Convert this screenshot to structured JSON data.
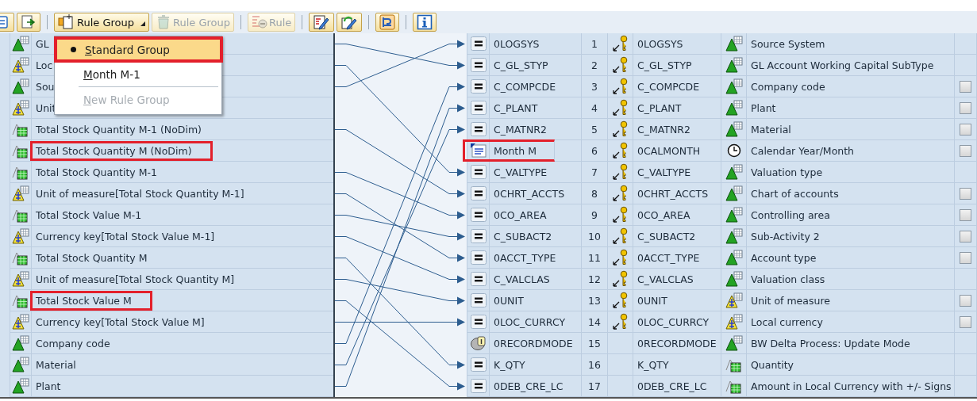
{
  "toolbar": [
    {
      "kind": "icon",
      "disabled": false
    },
    {
      "kind": "icon",
      "disabled": false
    },
    {
      "kind": "separator"
    },
    {
      "kind": "dropdown",
      "label": "Rule Group",
      "disabled": false
    },
    {
      "kind": "text",
      "label": "Rule Group",
      "disabled": true
    },
    {
      "kind": "separator"
    },
    {
      "kind": "text",
      "label": "Rule",
      "disabled": true
    },
    {
      "kind": "separator"
    },
    {
      "kind": "icon",
      "disabled": false
    },
    {
      "kind": "icon",
      "disabled": false
    },
    {
      "kind": "separator"
    },
    {
      "kind": "icon",
      "disabled": false
    },
    {
      "kind": "separator"
    },
    {
      "kind": "icon",
      "disabled": false
    }
  ],
  "menu": [
    {
      "kind": "item",
      "label": "Standard Group",
      "selected": true,
      "highlighted": true,
      "disabled": false
    },
    {
      "kind": "item",
      "label": "Month M-1",
      "selected": false,
      "highlighted": false,
      "disabled": false
    },
    {
      "kind": "separator"
    },
    {
      "kind": "item",
      "label": "New Rule Group",
      "selected": false,
      "highlighted": false,
      "disabled": true
    }
  ],
  "source_rows": [
    {
      "text": "GL",
      "kind": "characteristic",
      "highlighted": false
    },
    {
      "text": "Loc",
      "kind": "unit",
      "highlighted": false
    },
    {
      "text": "Sou",
      "kind": "characteristic",
      "highlighted": false
    },
    {
      "text": "Unit",
      "kind": "unit",
      "highlighted": false
    },
    {
      "text": "Total Stock Quantity M-1 (NoDim)",
      "kind": "keyfigure",
      "highlighted": false
    },
    {
      "text": "Total Stock Quantity M (NoDim)",
      "kind": "keyfigure",
      "highlighted": true
    },
    {
      "text": "Total Stock Quantity M-1",
      "kind": "keyfigure",
      "highlighted": false
    },
    {
      "text": "Unit of measure[Total Stock Quantity M-1]",
      "kind": "unit",
      "highlighted": false
    },
    {
      "text": "Total Stock Value M-1",
      "kind": "keyfigure",
      "highlighted": false
    },
    {
      "text": "Currency key[Total Stock Value M-1]",
      "kind": "unit",
      "highlighted": false
    },
    {
      "text": "Total Stock Quantity M",
      "kind": "keyfigure",
      "highlighted": false
    },
    {
      "text": "Unit of measure[Total Stock Quantity M]",
      "kind": "unit",
      "highlighted": false
    },
    {
      "text": "Total Stock Value M",
      "kind": "keyfigure",
      "highlighted": true
    },
    {
      "text": "Currency key[Total Stock Value M]",
      "kind": "unit",
      "highlighted": false
    },
    {
      "text": "Company code",
      "kind": "characteristic",
      "highlighted": false
    },
    {
      "text": "Material",
      "kind": "characteristic",
      "highlighted": false
    },
    {
      "text": "Plant",
      "kind": "characteristic",
      "highlighted": false
    }
  ],
  "target_rows": [
    {
      "source": {
        "kind": "field",
        "name": "0LOGSYS"
      },
      "number": "1",
      "key": true,
      "linked": true,
      "target": {
        "kind": "characteristic",
        "name": "0LOGSYS",
        "description": "Source System"
      },
      "checkbox": false,
      "highlighted": false
    },
    {
      "source": {
        "kind": "field",
        "name": "C_GL_STYP"
      },
      "number": "2",
      "key": true,
      "linked": true,
      "target": {
        "kind": "characteristic",
        "name": "C_GL_STYP",
        "description": "GL Account Working Capital SubType"
      },
      "checkbox": false,
      "highlighted": false
    },
    {
      "source": {
        "kind": "field",
        "name": "C_COMPCDE"
      },
      "number": "3",
      "key": true,
      "linked": true,
      "target": {
        "kind": "characteristic",
        "name": "C_COMPCDE",
        "description": "Company code"
      },
      "checkbox": true,
      "highlighted": false
    },
    {
      "source": {
        "kind": "field",
        "name": "C_PLANT"
      },
      "number": "4",
      "key": true,
      "linked": true,
      "target": {
        "kind": "characteristic",
        "name": "C_PLANT",
        "description": "Plant"
      },
      "checkbox": true,
      "highlighted": false
    },
    {
      "source": {
        "kind": "field",
        "name": "C_MATNR2"
      },
      "number": "5",
      "key": true,
      "linked": true,
      "target": {
        "kind": "characteristic",
        "name": "C_MATNR2",
        "description": "Material"
      },
      "checkbox": true,
      "highlighted": false
    },
    {
      "source": {
        "kind": "formula",
        "name": "Month M"
      },
      "number": "6",
      "key": true,
      "linked": false,
      "target": {
        "kind": "time",
        "name": "0CALMONTH",
        "description": "Calendar Year/Month"
      },
      "checkbox": true,
      "highlighted": true
    },
    {
      "source": {
        "kind": "field",
        "name": "C_VALTYPE"
      },
      "number": "7",
      "key": true,
      "linked": true,
      "target": {
        "kind": "characteristic",
        "name": "C_VALTYPE",
        "description": "Valuation type"
      },
      "checkbox": false,
      "highlighted": false
    },
    {
      "source": {
        "kind": "field",
        "name": "0CHRT_ACCTS"
      },
      "number": "8",
      "key": true,
      "linked": true,
      "target": {
        "kind": "characteristic",
        "name": "0CHRT_ACCTS",
        "description": "Chart of accounts"
      },
      "checkbox": true,
      "highlighted": false
    },
    {
      "source": {
        "kind": "field",
        "name": "0CO_AREA"
      },
      "number": "9",
      "key": true,
      "linked": true,
      "target": {
        "kind": "characteristic",
        "name": "0CO_AREA",
        "description": "Controlling area"
      },
      "checkbox": true,
      "highlighted": false
    },
    {
      "source": {
        "kind": "field",
        "name": "C_SUBACT2"
      },
      "number": "10",
      "key": true,
      "linked": true,
      "target": {
        "kind": "characteristic",
        "name": "C_SUBACT2",
        "description": "Sub-Activity 2"
      },
      "checkbox": true,
      "highlighted": false
    },
    {
      "source": {
        "kind": "field",
        "name": "0ACCT_TYPE"
      },
      "number": "11",
      "key": true,
      "linked": true,
      "target": {
        "kind": "characteristic",
        "name": "0ACCT_TYPE",
        "description": "Account type"
      },
      "checkbox": true,
      "highlighted": false
    },
    {
      "source": {
        "kind": "field",
        "name": "C_VALCLAS"
      },
      "number": "12",
      "key": true,
      "linked": true,
      "target": {
        "kind": "characteristic",
        "name": "C_VALCLAS",
        "description": "Valuation class"
      },
      "checkbox": false,
      "highlighted": false
    },
    {
      "source": {
        "kind": "field",
        "name": "0UNIT"
      },
      "number": "13",
      "key": true,
      "linked": true,
      "target": {
        "kind": "unit",
        "name": "0UNIT",
        "description": "Unit of measure"
      },
      "checkbox": true,
      "highlighted": false
    },
    {
      "source": {
        "kind": "field",
        "name": "0LOC_CURRCY"
      },
      "number": "14",
      "key": true,
      "linked": true,
      "target": {
        "kind": "unit",
        "name": "0LOC_CURRCY",
        "description": "Local currency"
      },
      "checkbox": true,
      "highlighted": false
    },
    {
      "source": {
        "kind": "record",
        "name": "0RECORDMODE"
      },
      "number": "15",
      "key": false,
      "linked": false,
      "target": {
        "kind": "characteristic",
        "name": "0RECORDMODE",
        "description": "BW Delta Process: Update Mode"
      },
      "checkbox": false,
      "highlighted": false
    },
    {
      "source": {
        "kind": "field",
        "name": "K_QTY"
      },
      "number": "16",
      "key": false,
      "linked": true,
      "target": {
        "kind": "keyfigure",
        "name": "K_QTY",
        "description": "Quantity"
      },
      "checkbox": false,
      "highlighted": false
    },
    {
      "source": {
        "kind": "field",
        "name": "0DEB_CRE_LC"
      },
      "number": "17",
      "key": false,
      "linked": true,
      "target": {
        "kind": "keyfigure",
        "name": "0DEB_CRE_LC",
        "description": "Amount in Local Currency with +/- Signs"
      },
      "checkbox": false,
      "highlighted": false
    }
  ]
}
